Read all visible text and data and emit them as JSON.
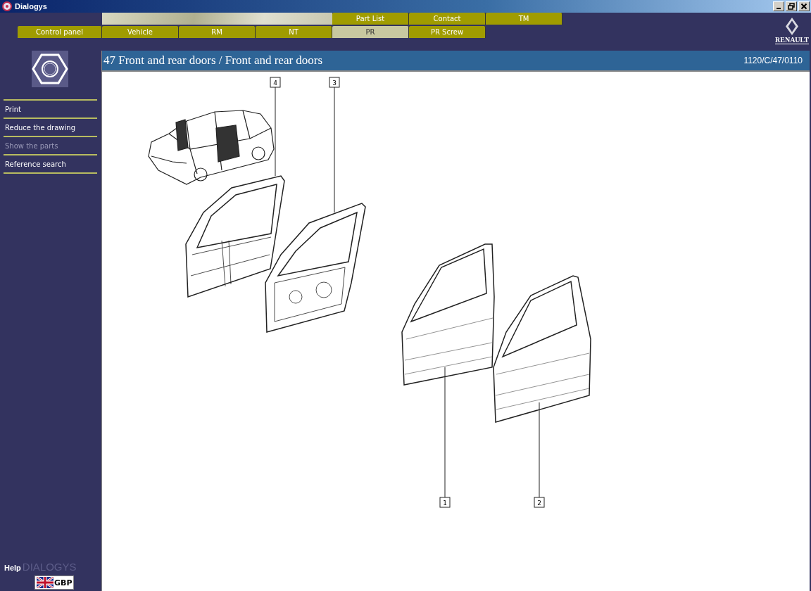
{
  "window": {
    "title": "Dialogys"
  },
  "tabs_top": [
    {
      "label": "Part List",
      "selected": false
    },
    {
      "label": "Contact",
      "selected": false
    },
    {
      "label": "TM",
      "selected": false
    }
  ],
  "tabs": [
    {
      "label": "Control panel",
      "selected": false
    },
    {
      "label": "Vehicle",
      "selected": false
    },
    {
      "label": "RM",
      "selected": false
    },
    {
      "label": "NT",
      "selected": false
    },
    {
      "label": "PR",
      "selected": true
    },
    {
      "label": "PR Screw",
      "selected": false
    }
  ],
  "brand": {
    "name": "RENAULT"
  },
  "sidebar": {
    "items": [
      {
        "label": "Print",
        "disabled": false
      },
      {
        "label": "Reduce the drawing",
        "disabled": false
      },
      {
        "label": "Show the parts",
        "disabled": true
      },
      {
        "label": "Reference search",
        "disabled": false
      }
    ],
    "help": "Help",
    "logo": "DIALOGYS",
    "currency": "GBP"
  },
  "page": {
    "title": "47 Front and rear doors / Front and rear doors",
    "reference": "1120/C/47/0110"
  },
  "callouts": [
    {
      "label": "4"
    },
    {
      "label": "3"
    },
    {
      "label": "1"
    },
    {
      "label": "2"
    }
  ]
}
